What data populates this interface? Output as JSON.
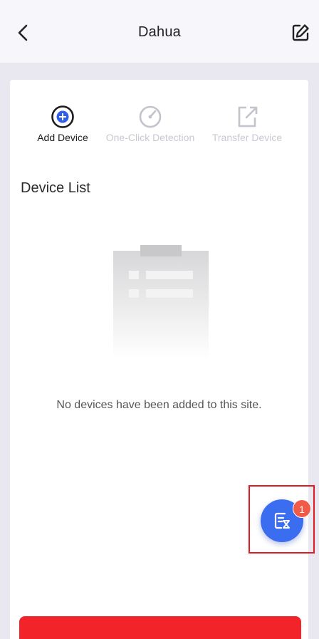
{
  "header": {
    "title": "Dahua",
    "back_icon": "chevron-left-icon",
    "edit_icon": "edit-icon"
  },
  "actions": [
    {
      "label": "Add Device",
      "icon": "add-circle-icon",
      "enabled": true
    },
    {
      "label": "One-Click Detection",
      "icon": "gauge-icon",
      "enabled": false
    },
    {
      "label": "Transfer Device",
      "icon": "transfer-icon",
      "enabled": false
    }
  ],
  "device_list": {
    "title": "Device List",
    "empty_message": "No devices have been added to this site."
  },
  "fab": {
    "icon": "task-list-icon",
    "badge_count": "1"
  },
  "colors": {
    "accent": "#3a6df0",
    "danger": "#f2242a",
    "badge": "#f25a48",
    "highlight": "#e11b22"
  }
}
